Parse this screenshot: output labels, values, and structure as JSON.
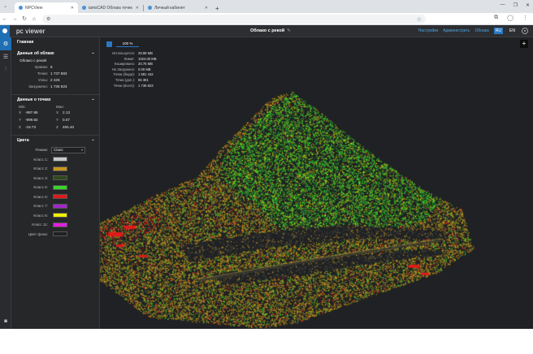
{
  "browser": {
    "tabs": [
      {
        "title": "NPCView",
        "active": true
      },
      {
        "title": "iamsCAD Облака точек",
        "active": false
      },
      {
        "title": "Личный кабинет",
        "active": false
      }
    ],
    "new_tab": "+"
  },
  "app": {
    "name": "pc viewer",
    "cloud_title": "Облако с рекой",
    "links": [
      "Настройки",
      "Администрить",
      "Облака"
    ],
    "languages": [
      {
        "code": "RU",
        "selected": true
      },
      {
        "code": "EN",
        "selected": false
      }
    ],
    "accent": "#2b79c2"
  },
  "panel": {
    "main_title": "Главная",
    "cloud_section": {
      "title": "Данные об облаке",
      "name": "Облако с рекой",
      "rows": [
        {
          "k": "Уровни:",
          "v": "6"
        },
        {
          "k": "Точки:",
          "v": "1 737 883"
        },
        {
          "k": "Узлы:",
          "v": "2 426"
        },
        {
          "k": "Загружено:",
          "v": "1 736 823"
        }
      ]
    },
    "points_section": {
      "title": "Данные о точках",
      "min_label": "Min:",
      "max_label": "Max:",
      "rows": [
        {
          "ax": "X",
          "min": "-997.86",
          "max_ax": "X",
          "max": "2.13"
        },
        {
          "ax": "Y",
          "min": "-999.92",
          "max_ax": "Y",
          "max": "0.07"
        },
        {
          "ax": "Z",
          "min": "-18.73",
          "max_ax": "Z",
          "max": "455.40"
        }
      ]
    },
    "colors_section": {
      "title": "Цвета",
      "mode_label": "Режим:",
      "mode_value": "Class",
      "classes": [
        {
          "label": "Класс 1:",
          "color": "#c8c8c8"
        },
        {
          "label": "Класс 2:",
          "color": "#c8961e"
        },
        {
          "label": "Класс 3:",
          "color": "#2f4a1c"
        },
        {
          "label": "Класс 5:",
          "color": "#3ad42a"
        },
        {
          "label": "Класс 6:",
          "color": "#e01a1a"
        },
        {
          "label": "Класс 7:",
          "color": "#a028c8"
        },
        {
          "label": "Класс 8:",
          "color": "#f0f000"
        },
        {
          "label": "Класс 11:",
          "color": "#e020e0"
        },
        {
          "label": "Цвет фона:",
          "color": "#202124"
        }
      ]
    }
  },
  "viewer": {
    "progress_text": "100 %",
    "progress": 1.0,
    "stats": [
      {
        "k": "Используется:",
        "v": "28.88 MB"
      },
      {
        "k": "Лимит:",
        "v": "1024.00 MB"
      },
      {
        "k": "Кэшировано:",
        "v": "20.75 MB"
      },
      {
        "k": "Не Загружено:",
        "v": "0.00 MB"
      },
      {
        "k": "Точки (бюдж):",
        "v": "1 681 442"
      },
      {
        "k": "Точки (доп.):",
        "v": "55 381"
      },
      {
        "k": "Точки (всего):",
        "v": "1 736 823"
      }
    ],
    "plus_label": "+"
  }
}
